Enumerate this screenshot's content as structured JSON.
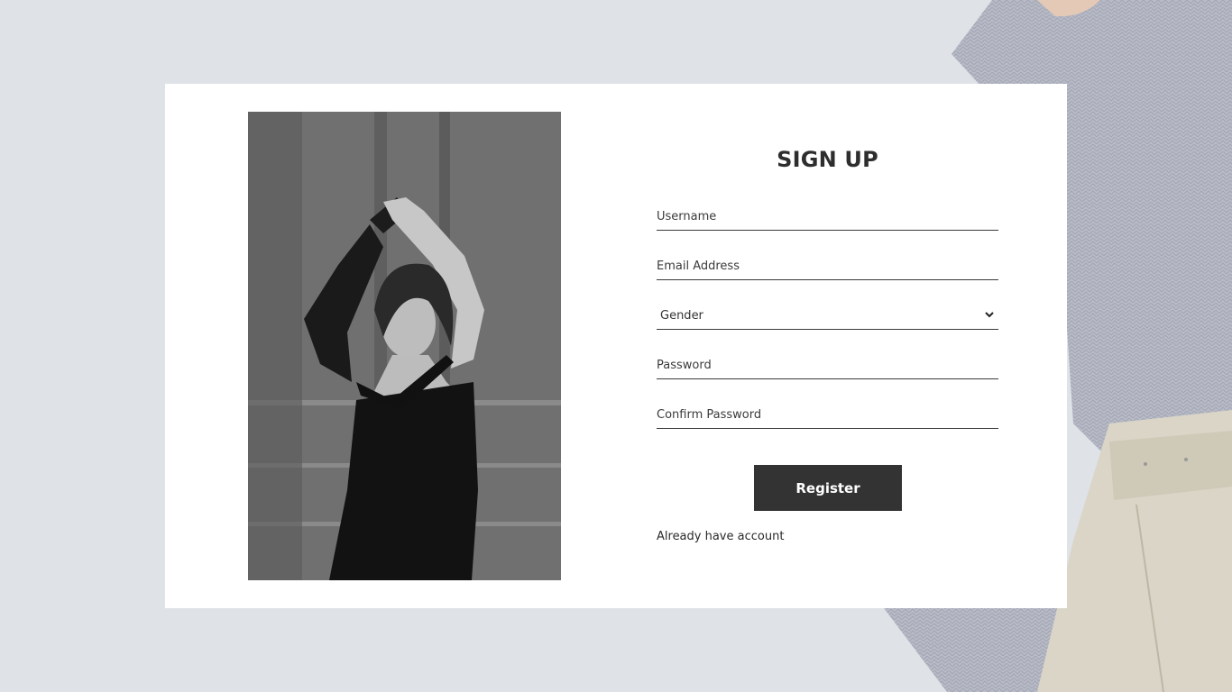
{
  "colors": {
    "page_background": "#dfe3e7",
    "card_background": "#ffffff",
    "button_background": "#333333",
    "button_text": "#ffffff",
    "title": "#2e2e2e",
    "underline": "#3a3a3a"
  },
  "form": {
    "title": "SIGN UP",
    "username": {
      "placeholder": "Username",
      "value": ""
    },
    "email": {
      "placeholder": "Email Address",
      "value": ""
    },
    "gender": {
      "selected": "Gender",
      "icon": "chevron-down-icon"
    },
    "password": {
      "placeholder": "Password",
      "value": ""
    },
    "confirm_password": {
      "placeholder": "Confirm Password",
      "value": ""
    },
    "register_label": "Register",
    "login_link": "Already have account"
  }
}
